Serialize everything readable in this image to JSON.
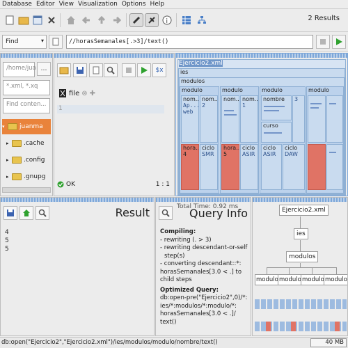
{
  "menu": [
    "Database",
    "Editor",
    "View",
    "Visualization",
    "Options",
    "Help"
  ],
  "menu_underline": [
    "D",
    "E",
    "V",
    "V",
    "O",
    "H"
  ],
  "toolbar": {
    "results_count": "2 Results",
    "icons": [
      "new-database-icon",
      "open-database-icon",
      "properties-icon",
      "close-icon",
      "home-icon",
      "back-icon",
      "up-icon",
      "forward-icon",
      "text-view-icon",
      "map-view-icon",
      "info-view-icon",
      "table-icon",
      "tree-icon"
    ]
  },
  "find": {
    "mode": "Find",
    "query": "//horasSemanales[.>3]/text()"
  },
  "left": {
    "path": "/home/jua",
    "filter": "*.xml, *.xq",
    "find_contents": "Find conten...",
    "tree": [
      "juanma",
      ".cache",
      ".config",
      ".gnupg"
    ]
  },
  "editor": {
    "tab": "file",
    "line_number": "1",
    "status": "OK",
    "position": "1 : 1"
  },
  "map": {
    "root_file": "Ejercicio2.xml",
    "ies": "ies",
    "modulos": "modulos",
    "modulo": "modulo",
    "nom": "nom...",
    "nombre": "nombre",
    "curso": "curso",
    "hora": "hora...",
    "ciclo": "ciclo",
    "ap_web": "Ap... web",
    "two": "2",
    "one": "1",
    "three": "3",
    "four": "4",
    "five": "5",
    "smr": "SMR",
    "asir": "ASIR",
    "daw": "DAW"
  },
  "result": {
    "title": "Result",
    "lines": [
      "4",
      "5",
      "5"
    ]
  },
  "query_info": {
    "title": "Query Info",
    "total_time": "Total Time: 0.92 ms",
    "compiling_label": "Compiling:",
    "compiling": [
      "- rewriting (. > 3)",
      "- rewriting descendant-or-self",
      "  step(s)",
      "- converting descendant::*:",
      "horasSemanales[3.0 < .] to",
      "child steps"
    ],
    "optimized_label": "Optimized Query:",
    "optimized": [
      "db:open-pre(\"Ejercicio2\",0)/*:",
      "ies/*:modulos/*:modulo/*:",
      "horasSemanales[3.0 < .]/",
      "text()"
    ]
  },
  "plan": {
    "root": "Ejercicio2.xml",
    "ies": "ies",
    "modulos": "modulos",
    "modulo": "modulo"
  },
  "statusbar": {
    "text": "db:open(\"Ejercicio2\",\"Ejercicio2.xml\")/ies/modulos/modulo/nombre/text()",
    "memory": "40 MB"
  },
  "colors": {
    "accent_blue": "#7da7d9",
    "treemap_fill": "#c9dbef",
    "hit_red": "#e07365",
    "run_green": "#2fa12f"
  }
}
